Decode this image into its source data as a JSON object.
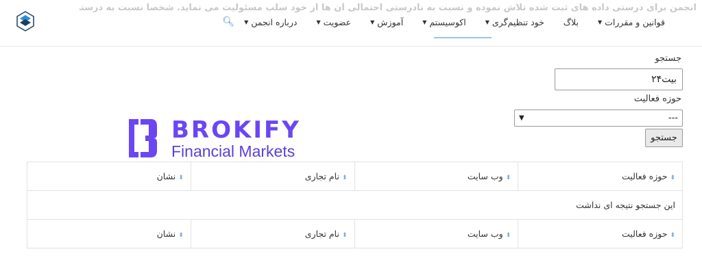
{
  "header": {
    "disclaimer": "انجمن برای درستی داده های ثبت شده تلاش نموده و نسبت به نادرستی احتمالی آن ها از خود سلب مسئولیت می نماید. شخصاً نسبت به درستی اطلاعات، خود تحقیق لازم بعمل آورید.",
    "nav": [
      {
        "label": "درباره انجمن",
        "dropdown": true
      },
      {
        "label": "عضویت",
        "dropdown": true
      },
      {
        "label": "آموزش",
        "dropdown": true
      },
      {
        "label": "اکوسیستم",
        "dropdown": true,
        "active": true
      },
      {
        "label": "خود تنظیم‌گری",
        "dropdown": true
      },
      {
        "label": "بلاگ",
        "dropdown": false
      },
      {
        "label": "قوانین و مقررات",
        "dropdown": true
      }
    ],
    "search_icon": "search-icon",
    "accent_color": "#3b7fd0"
  },
  "form": {
    "search_label": "جستجو",
    "search_value": "بیت۲۴",
    "field_label": "حوزه فعالیت",
    "select_value": "---",
    "submit_label": "جستجو"
  },
  "brand": {
    "name": "BROKIFY",
    "tagline": "Financial Markets",
    "color": "#6b46f3"
  },
  "table": {
    "columns": [
      "حوزه فعالیت",
      "وب سایت",
      "نام تجاری",
      "نشان"
    ],
    "empty_message": "این جستجو نتیجه ای نداشت"
  }
}
